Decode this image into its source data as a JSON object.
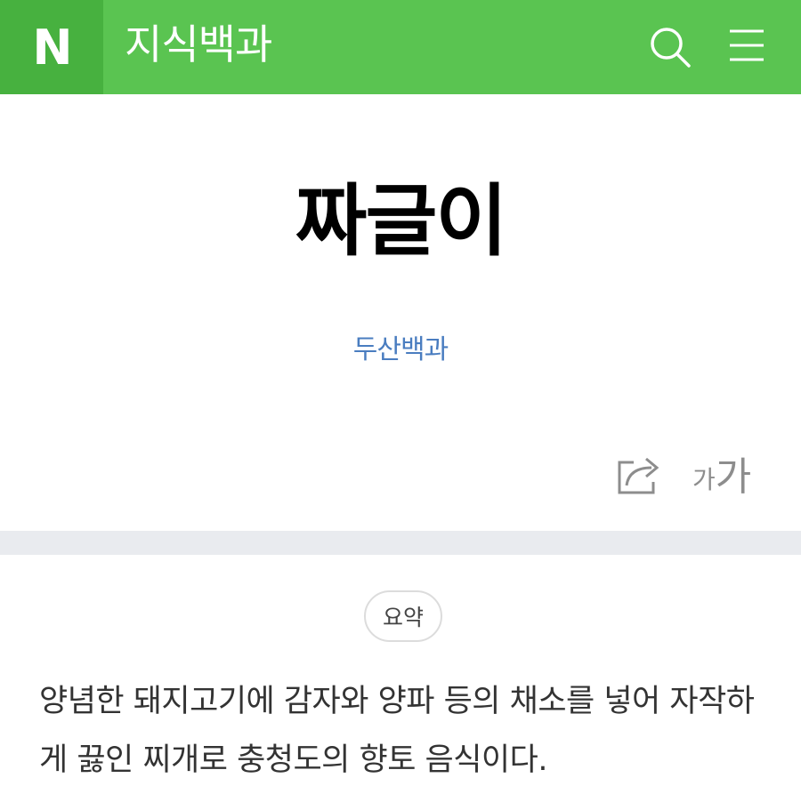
{
  "header": {
    "logo_text": "N",
    "site_title": "지식백과",
    "search_icon": "search-icon",
    "menu_icon": "menu-icon",
    "bar_color": "#5ac451",
    "logo_bg_color": "#47b13f"
  },
  "article": {
    "title": "짜글이",
    "source": "두산백과",
    "source_color": "#4a7dc0",
    "share_icon": "share-icon",
    "font_size_small": "가",
    "font_size_large": "가"
  },
  "summary": {
    "badge": "요약",
    "text": "양념한 돼지고기에 감자와 양파 등의 채소를 넣어 자작하게 끓인 찌개로 충청도의 향토 음식이다."
  }
}
